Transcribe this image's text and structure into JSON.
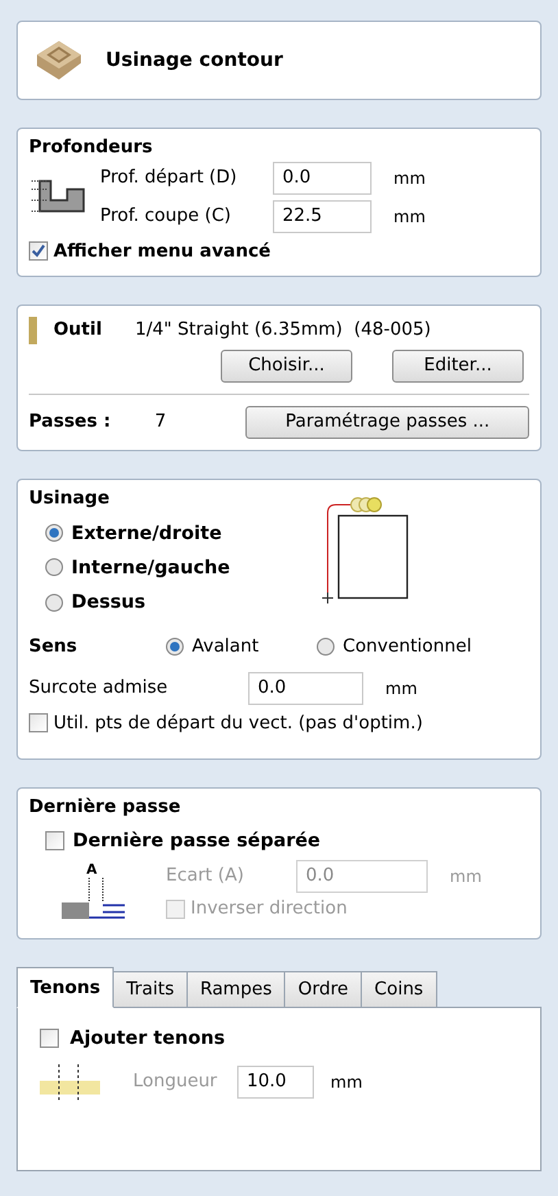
{
  "header": {
    "title": "Usinage contour"
  },
  "depths": {
    "title": "Profondeurs",
    "fields": [
      {
        "label": "Prof. départ (D)",
        "value": "0.0",
        "unit": "mm"
      },
      {
        "label": "Prof. coupe (C)",
        "value": "22.5",
        "unit": "mm"
      }
    ],
    "advanced": {
      "label": "Afficher menu avancé",
      "checked": true
    }
  },
  "tool": {
    "label": "Outil",
    "name": "1/4\" Straight (6.35mm)  (48-005)",
    "buttons": [
      "Choisir...",
      "Editer..."
    ],
    "passes_label": "Passes :",
    "passes_value": "7",
    "passes_button": "Paramétrage passes ..."
  },
  "machining": {
    "title": "Usinage",
    "options": [
      {
        "label": "Externe/droite",
        "selected": true
      },
      {
        "label": "Interne/gauche",
        "selected": false
      },
      {
        "label": "Dessus",
        "selected": false
      }
    ],
    "direction_label": "Sens",
    "directions": [
      {
        "label": "Avalant",
        "selected": true
      },
      {
        "label": "Conventionnel",
        "selected": false
      }
    ],
    "allowance": {
      "label": "Surcote admise",
      "value": "0.0",
      "unit": "mm"
    },
    "use_start": {
      "label": "Util. pts de départ du vect. (pas d'optim.)",
      "checked": false
    }
  },
  "last_pass": {
    "title": "Dernière passe",
    "separate": {
      "label": "Dernière passe séparée",
      "checked": false
    },
    "gap": {
      "label": "Ecart (A)",
      "value": "0.0",
      "unit": "mm",
      "disabled": true
    },
    "marker": "A",
    "reverse": {
      "label": "Inverser direction",
      "checked": false,
      "disabled": true
    }
  },
  "tabs": [
    {
      "label": "Tenons",
      "selected": true
    },
    {
      "label": "Traits",
      "selected": false
    },
    {
      "label": "Rampes",
      "selected": false
    },
    {
      "label": "Ordre",
      "selected": false
    },
    {
      "label": "Coins",
      "selected": false
    }
  ],
  "tenons": {
    "add": {
      "label": "Ajouter tenons",
      "checked": false
    },
    "length": {
      "label": "Longueur",
      "value": "10.0",
      "unit": "mm"
    }
  }
}
